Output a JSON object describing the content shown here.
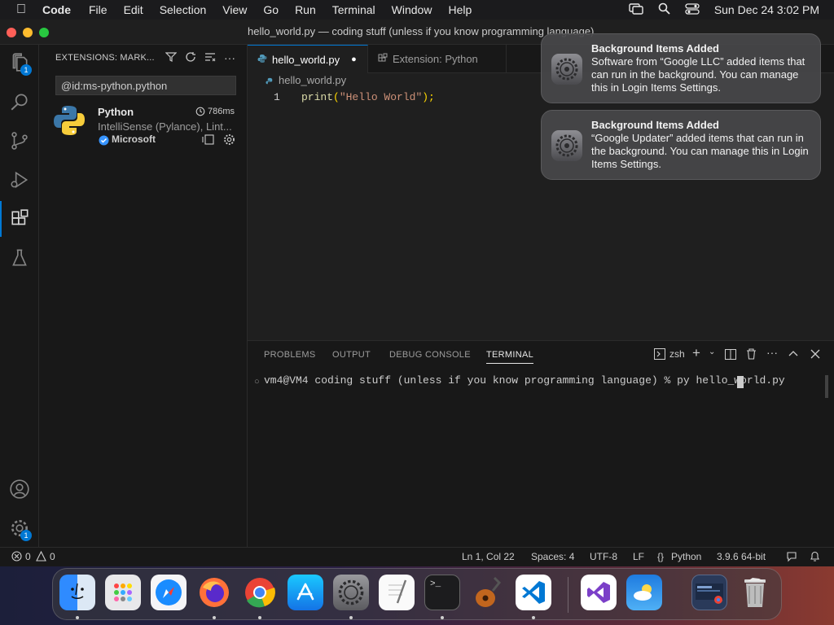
{
  "menubar": {
    "app": "Code",
    "items": [
      "File",
      "Edit",
      "Selection",
      "View",
      "Go",
      "Run",
      "Terminal",
      "Window",
      "Help"
    ],
    "clock": "Sun Dec 24  3:02 PM"
  },
  "window": {
    "title": "hello_world.py — coding stuff (unless if you know programming language)"
  },
  "activity": {
    "explorer_badge": "1",
    "manage_badge": "1"
  },
  "sidebar": {
    "header": "EXTENSIONS: MARK...",
    "search_value": "@id:ms-python.python",
    "extension": {
      "name": "Python",
      "time": "786ms",
      "description": "IntelliSense (Pylance), Lint...",
      "publisher": "Microsoft"
    }
  },
  "tabs": [
    {
      "label": "hello_world.py",
      "dirty": "●"
    },
    {
      "label": "Extension: Python"
    }
  ],
  "editor": {
    "breadcrumb": "hello_world.py",
    "line_number": "1",
    "code_fn": "print",
    "code_open": "(",
    "code_string": "\"Hello World\"",
    "code_close": ");"
  },
  "panel": {
    "tabs": [
      "PROBLEMS",
      "OUTPUT",
      "DEBUG CONSOLE",
      "TERMINAL"
    ],
    "shell": "zsh",
    "terminal_line": "vm4@VM4 coding stuff (unless if you know programming language) % py hello_world.py"
  },
  "statusbar": {
    "errors": "0",
    "warnings": "0",
    "position": "Ln 1, Col 22",
    "spaces": "Spaces: 4",
    "encoding": "UTF-8",
    "eol": "LF",
    "language": "Python",
    "interpreter": "3.9.6 64-bit"
  },
  "notifications": [
    {
      "title": "Background Items Added",
      "body": "Software from “Google LLC” added items that can run in the background. You can manage this in Login Items Settings."
    },
    {
      "title": "Background Items Added",
      "body": "“Google Updater” added items that can run in the background. You can manage this in Login Items Settings."
    }
  ],
  "colors": {
    "accent": "#0078d4",
    "string": "#ce9178",
    "function": "#dcdcaa"
  }
}
